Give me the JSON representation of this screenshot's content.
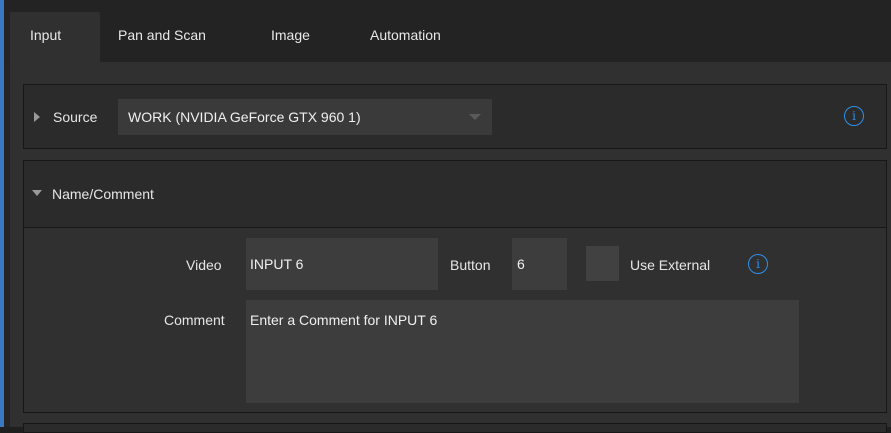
{
  "tabs": [
    {
      "label": "Input",
      "active": true
    },
    {
      "label": "Pan and Scan",
      "active": false
    },
    {
      "label": "Image",
      "active": false
    },
    {
      "label": "Automation",
      "active": false
    }
  ],
  "source": {
    "label": "Source",
    "value": "WORK (NVIDIA GeForce GTX 960 1)",
    "info_icon": "info-icon"
  },
  "name_comment": {
    "header": "Name/Comment",
    "video_label": "Video",
    "video_value": "INPUT 6",
    "button_label": "Button",
    "button_value": "6",
    "use_external_label": "Use External",
    "use_external_checked": false,
    "comment_label": "Comment",
    "comment_value": "Enter a Comment for INPUT 6"
  },
  "colors": {
    "accent": "#2f8fe8",
    "panel": "#303030",
    "field": "#3d3d3d"
  }
}
